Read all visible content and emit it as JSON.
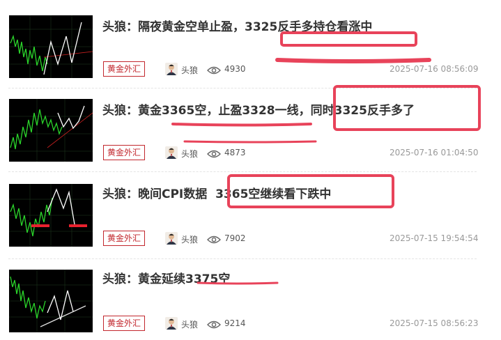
{
  "accent_color": "#c2272d",
  "annotation_color": "#e8435a",
  "articles": [
    {
      "title": "头狼：隔夜黄金空单止盈，3325反手多持仓看涨中",
      "tag": "黄金外汇",
      "author": "头狼",
      "views": "4930",
      "date": "2025-07-16 08:56:09"
    },
    {
      "title": "头狼：黄金3365空，止盈3328一线，同时3325反手多了",
      "tag": "黄金外汇",
      "author": "头狼",
      "views": "4873",
      "date": "2025-07-16 01:04:50"
    },
    {
      "title": "头狼：晚间CPI数据  3365空继续看下跌中",
      "tag": "黄金外汇",
      "author": "头狼",
      "views": "7902",
      "date": "2025-07-15 19:54:54"
    },
    {
      "title": "头狼：黄金延续3375空",
      "tag": "黄金外汇",
      "author": "头狼",
      "views": "9214",
      "date": "2025-07-15 08:56:23"
    }
  ],
  "icons": {
    "views": "eye-icon",
    "author": "author-avatar"
  }
}
